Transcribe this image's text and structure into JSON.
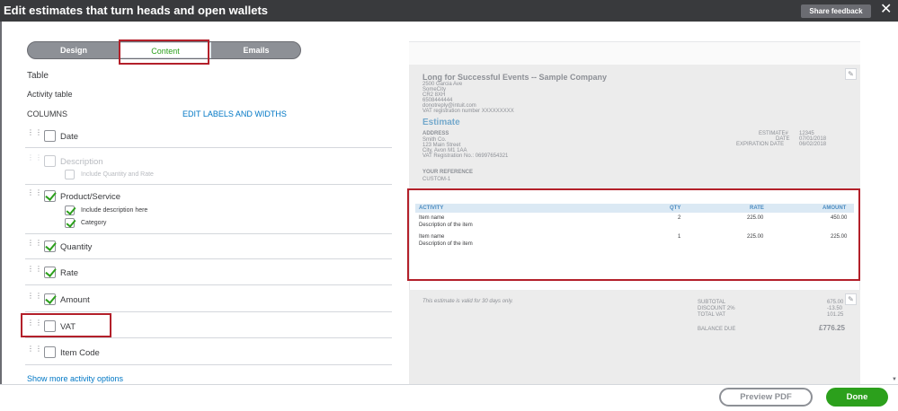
{
  "window": {
    "title": "Edit estimates that turn heads and open wallets",
    "share_feedback": "Share feedback",
    "close_glyph": "✕"
  },
  "tabs": [
    {
      "label": "Design",
      "active": false
    },
    {
      "label": "Content",
      "active": true
    },
    {
      "label": "Emails",
      "active": false
    }
  ],
  "panel": {
    "section": "Table",
    "subsection": "Activity table",
    "columns_heading": "COLUMNS",
    "edit_link": "EDIT LABELS AND WIDTHS",
    "show_more": "Show more activity options"
  },
  "columns": [
    {
      "label": "Date",
      "checked": false,
      "disabled": false
    },
    {
      "label": "Description",
      "checked": false,
      "disabled": true,
      "sub": [
        {
          "label": "Include Quantity and Rate",
          "checked": false,
          "disabled": true
        }
      ]
    },
    {
      "label": "Product/Service",
      "checked": true,
      "disabled": false,
      "sub": [
        {
          "label": "Include description here",
          "checked": true,
          "disabled": false
        },
        {
          "label": "Category",
          "checked": true,
          "disabled": false
        }
      ]
    },
    {
      "label": "Quantity",
      "checked": true,
      "disabled": false
    },
    {
      "label": "Rate",
      "checked": true,
      "disabled": false
    },
    {
      "label": "Amount",
      "checked": true,
      "disabled": false
    },
    {
      "label": "VAT",
      "checked": false,
      "disabled": false
    },
    {
      "label": "Item Code",
      "checked": false,
      "disabled": false
    }
  ],
  "preview": {
    "company": "Long for Successful Events -- Sample Company",
    "company_lines": [
      "2500 Garcia Ave",
      "SomeCity",
      "CR2 8XH",
      "6508444444",
      "donotreply@intuit.com",
      "VAT registration number XXXXXXXXX"
    ],
    "doc_title": "Estimate",
    "address_heading": "ADDRESS",
    "address_lines": [
      "Smith Co.",
      "123 Main Street",
      "City, Avon M1 1AA",
      "VAT Registration No.: 06997654321"
    ],
    "meta_labels": [
      "ESTIMATE#",
      "DATE",
      "EXPIRATION DATE"
    ],
    "meta_values": [
      "12345",
      "07/01/2018",
      "06/02/2018"
    ],
    "reference_heading": "YOUR REFERENCE",
    "reference_value": "CUSTOM-1",
    "table_headers": [
      "ACTIVITY",
      "QTY",
      "RATE",
      "AMOUNT"
    ],
    "rows": [
      {
        "name": "Item name",
        "desc": "Description of the item",
        "qty": "2",
        "rate": "225.00",
        "amount": "450.00"
      },
      {
        "name": "Item name",
        "desc": "Description of the item",
        "qty": "1",
        "rate": "225.00",
        "amount": "225.00"
      }
    ],
    "validity_note": "This estimate is valid for 30 days only.",
    "totals_labels": [
      "SUBTOTAL",
      "DISCOUNT 2%",
      "TOTAL VAT"
    ],
    "totals_values": [
      "675.00",
      "-13.50",
      "101.25"
    ],
    "balance_label": "BALANCE DUE",
    "balance_value": "£776.25",
    "edit_glyph": "✎"
  },
  "footer": {
    "preview_pdf": "Preview PDF",
    "done": "Done"
  },
  "colors": {
    "accent_green": "#2ca01c",
    "link_blue": "#0077c5",
    "highlight_red": "#b3202a",
    "title_bar": "#393a3d"
  }
}
